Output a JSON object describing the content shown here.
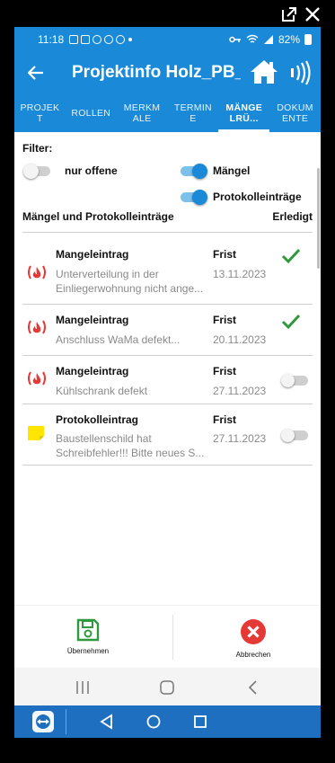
{
  "statusbar": {
    "time": "11:18",
    "battery": "82%"
  },
  "appbar": {
    "title": "Projektinfo Holz_PB_..."
  },
  "tabs": [
    {
      "label": "PROJEKT",
      "active": false
    },
    {
      "label": "ROLLEN",
      "active": false
    },
    {
      "label": "MERKMALE",
      "active": false
    },
    {
      "label": "TERMINE",
      "active": false
    },
    {
      "label": "MÄNGELRÜ...",
      "active": true
    },
    {
      "label": "DOKUMENTE",
      "active": false
    }
  ],
  "filter": {
    "label": "Filter:",
    "nur_offene": {
      "label": "nur offene",
      "on": false
    },
    "maengel": {
      "label": "Mängel",
      "on": true
    },
    "protokolleintraege": {
      "label": "Protokolleinträge",
      "on": true
    }
  },
  "list": {
    "header_left": "Mängel und Protokolleinträge",
    "header_right": "Erledigt",
    "rows": [
      {
        "type": "Mangeleintrag",
        "icon": "fire-warning-icon",
        "description": "Unterverteilung in der Einliegerwohnung nicht ange...",
        "frist_label": "Frist",
        "date": "13.11.2023",
        "done": true
      },
      {
        "type": "Mangeleintrag",
        "icon": "fire-warning-icon",
        "description": "Anschluss WaMa defekt...",
        "frist_label": "Frist",
        "date": "20.11.2023",
        "done": true
      },
      {
        "type": "Mangeleintrag",
        "icon": "fire-warning-icon",
        "description": "Kühlschrank defekt",
        "frist_label": "Frist",
        "date": "27.11.2023",
        "done": false
      },
      {
        "type": "Protokolleintrag",
        "icon": "sticky-note-icon",
        "description": "Baustellenschild hat Schreibfehler!!! Bitte neues S...",
        "frist_label": "Frist",
        "date": "27.11.2023",
        "done": false
      }
    ]
  },
  "actions": {
    "save_label": "Übernehmen",
    "cancel_label": "Abbrechen"
  },
  "colors": {
    "primary": "#1a8ad8",
    "save_green": "#2e9a3c",
    "cancel_red": "#e53935",
    "check_green": "#2e9a3c",
    "fire_red": "#e53935",
    "note_yellow": "#ffe500",
    "bottom_strip": "#1f6fc0"
  }
}
